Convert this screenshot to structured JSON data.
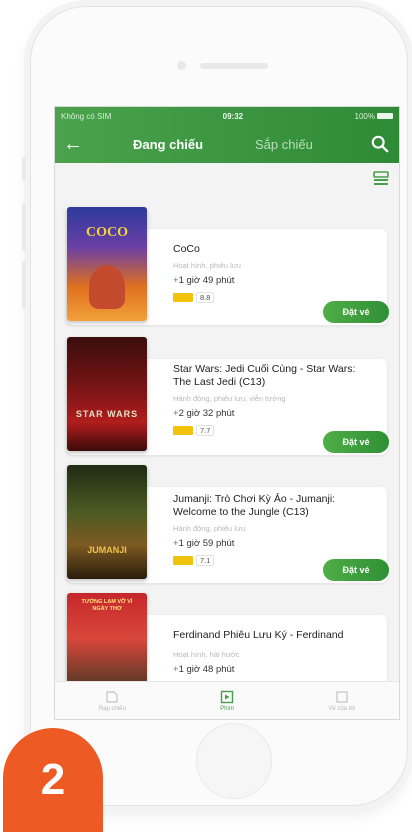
{
  "status_bar": {
    "carrier": "Không có SIM",
    "time": "09:32",
    "battery": "100%"
  },
  "nav": {
    "active_tab": "Đang chiếu",
    "inactive_tab": "Sắp chiếu"
  },
  "movies": [
    {
      "title": "CoCo",
      "genre": "Hoạt hình, phiêu lưu",
      "duration": "1 giờ 49 phút",
      "score": "8.8",
      "book_label": "Đặt vé",
      "poster_label": "COCO"
    },
    {
      "title": "Star Wars: Jedi Cuối Cùng - Star Wars: The Last Jedi (C13)",
      "genre": "Hành động, phiêu lưu, viễn tưởng",
      "duration": "2 giờ 32 phút",
      "score": "7.7",
      "book_label": "Đặt vé",
      "poster_label": "STAR WARS"
    },
    {
      "title": "Jumanji: Trò Chơi Kỳ Ảo - Jumanji: Welcome to the Jungle (C13)",
      "genre": "Hành động, phiêu lưu",
      "duration": "1 giờ 59 phút",
      "score": "7.1",
      "book_label": "Đặt vé",
      "poster_label": "JUMANJI"
    },
    {
      "title": "Ferdinand Phiêu Lưu Ký - Ferdinand",
      "genre": "Hoạt hình, hài hước",
      "duration": "1 giờ 48 phút",
      "poster_label": "TƯỞNG LẠM VỠ VÌ NGÀY THƠ"
    }
  ],
  "bottom_tabs": [
    {
      "label": "Rạp chiếu"
    },
    {
      "label": "Phim"
    },
    {
      "label": "Vé của tôi"
    }
  ],
  "step_number": "2",
  "colors": {
    "brand_green": "#3a9a40",
    "step_orange": "#ee5a24",
    "rating_yellow": "#f2c30c"
  }
}
